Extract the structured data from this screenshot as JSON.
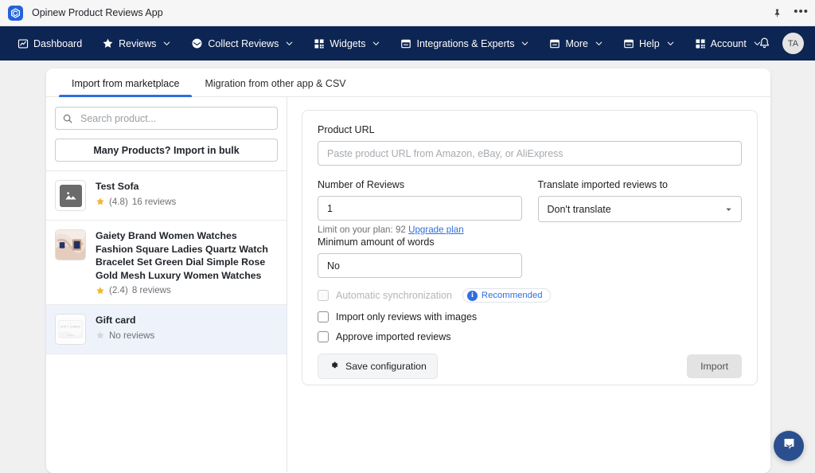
{
  "window": {
    "title": "Opinew Product Reviews App",
    "logo_icon": "opinew-logo-icon",
    "pin_icon": "pin-icon",
    "more_icon": "ellipsis-icon",
    "more_glyph": "•••"
  },
  "nav": {
    "items": [
      {
        "label": "Dashboard",
        "icon": "chart-line-icon",
        "caret": false
      },
      {
        "label": "Reviews",
        "icon": "star-icon",
        "caret": true
      },
      {
        "label": "Collect Reviews",
        "icon": "envelope-icon",
        "caret": true
      },
      {
        "label": "Widgets",
        "icon": "grid-squares-icon",
        "caret": true
      },
      {
        "label": "Integrations & Experts",
        "icon": "inbox-icon",
        "caret": true
      },
      {
        "label": "More",
        "icon": "inbox-icon",
        "caret": true
      },
      {
        "label": "Help",
        "icon": "inbox-icon",
        "caret": true
      },
      {
        "label": "Account",
        "icon": "grid-squares-icon",
        "caret": true
      }
    ],
    "bell_icon": "notification-bell-icon",
    "avatar_initials": "TA",
    "background": "#0d2552"
  },
  "tabs": [
    {
      "label": "Import from marketplace",
      "active": true
    },
    {
      "label": "Migration from other app & CSV",
      "active": false
    }
  ],
  "sidebar": {
    "search": {
      "placeholder": "Search product...",
      "value": "",
      "icon": "search-icon"
    },
    "bulk_import_button": "Many Products? Import in bulk",
    "products": [
      {
        "title": "Test Sofa",
        "rating": "(4.8)",
        "reviews": "16 reviews",
        "has_rating": true,
        "thumb": "placeholder-image-icon",
        "selected": false
      },
      {
        "title": "Gaiety Brand Women Watches Fashion Square Ladies Quartz Watch Bracelet Set Green Dial Simple Rose Gold Mesh Luxury Women Watches",
        "rating": "(2.4)",
        "reviews": "8 reviews",
        "has_rating": true,
        "thumb": "watch-photo",
        "selected": false
      },
      {
        "title": "Gift card",
        "rating": "",
        "reviews": "No reviews",
        "has_rating": false,
        "thumb": "gift-card-photo",
        "selected": true
      }
    ]
  },
  "form": {
    "product_url": {
      "label": "Product URL",
      "placeholder": "Paste product URL from Amazon, eBay, or AliExpress",
      "value": ""
    },
    "number_of_reviews": {
      "label": "Number of Reviews",
      "value": "1"
    },
    "limit_text": "Limit on your plan: 92",
    "upgrade_link": "Upgrade plan",
    "translate": {
      "label": "Translate imported reviews to",
      "selected": "Don't translate"
    },
    "minimum_words": {
      "label": "Minimum amount of words",
      "value": "No"
    },
    "checkboxes": [
      {
        "label": "Automatic synchronization",
        "checked": false,
        "disabled": true,
        "badge": "Recommended",
        "badge_icon": "info-icon"
      },
      {
        "label": "Import only reviews with images",
        "checked": false,
        "disabled": false,
        "badge": ""
      },
      {
        "label": "Approve imported reviews",
        "checked": false,
        "disabled": false,
        "badge": ""
      }
    ],
    "save_button": "Save configuration",
    "save_icon": "gear-icon",
    "import_button": "Import"
  },
  "chat": {
    "icon": "chat-message-icon",
    "color": "#2b4f8e"
  },
  "colors": {
    "accent": "#2f6ee0",
    "nav_bg": "#0d2552",
    "page_bg": "#f0f0f0",
    "star": "#f5b52e"
  }
}
